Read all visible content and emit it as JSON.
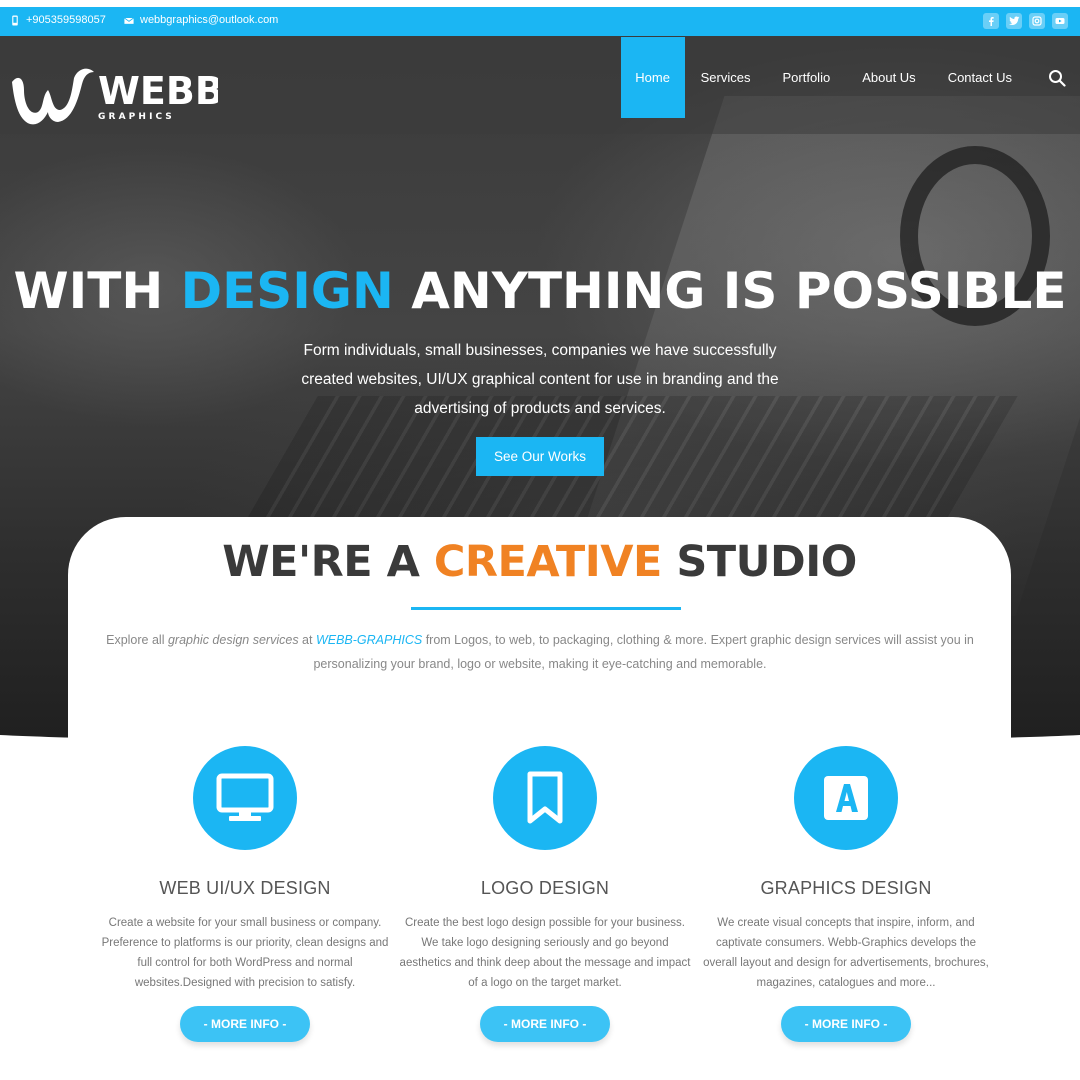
{
  "topbar": {
    "phone": "+905359598057",
    "email": "webbgraphics@outlook.com",
    "social": [
      "facebook-icon",
      "twitter-icon",
      "instagram-icon",
      "youtube-icon"
    ]
  },
  "brand": {
    "name": "WEBB",
    "tagline": "G R A P H I C S",
    "accent": "#1bb6f3"
  },
  "nav": {
    "items": [
      "Home",
      "Services",
      "Portfolio",
      "About Us",
      "Contact Us"
    ],
    "active": "Home"
  },
  "hero": {
    "title_pre": "WITH ",
    "title_accent": "DESIGN",
    "title_post": " ANYTHING IS POSSIBLE",
    "line1": "Form individuals, small businesses, companies we have successfully",
    "line2": "created websites, UI/UX graphical content for use in branding and the",
    "line3": "advertising of products and services.",
    "button": "See Our Works"
  },
  "studio": {
    "title_pre": "WE'RE A ",
    "title_accent": "CREATIVE",
    "title_post": " STUDIO",
    "desc_1": "Explore all ",
    "desc_2": "graphic design services",
    "desc_3": " at ",
    "desc_link": "WEBB-GRAPHICS",
    "desc_4": " from Logos, to web, to packaging, clothing & more. Expert graphic design services will assist you in personalizing your brand, logo or website, making it eye-catching and memorable.",
    "accent": "#f08223"
  },
  "services": [
    {
      "icon": "monitor-icon",
      "title": "WEB UI/UX DESIGN",
      "desc": "Create a website for your small business or company. Preference to platforms is our priority, clean designs and full control for both WordPress and normal websites.Designed with precision to satisfy.",
      "button": "- MORE INFO -"
    },
    {
      "icon": "bookmark-icon",
      "title": "LOGO DESIGN",
      "desc": "Create the best logo design possible for your business. We take logo designing seriously and go beyond aesthetics and think deep about the message and impact of a logo on the target market.",
      "button": "- MORE INFO -"
    },
    {
      "icon": "letter-a-icon",
      "title": "GRAPHICS DESIGN",
      "desc": "We create visual concepts that inspire, inform, and captivate consumers. Webb-Graphics develops the overall layout and design for advertisements, brochures, magazines, catalogues and more...",
      "button": "- MORE INFO -"
    }
  ]
}
